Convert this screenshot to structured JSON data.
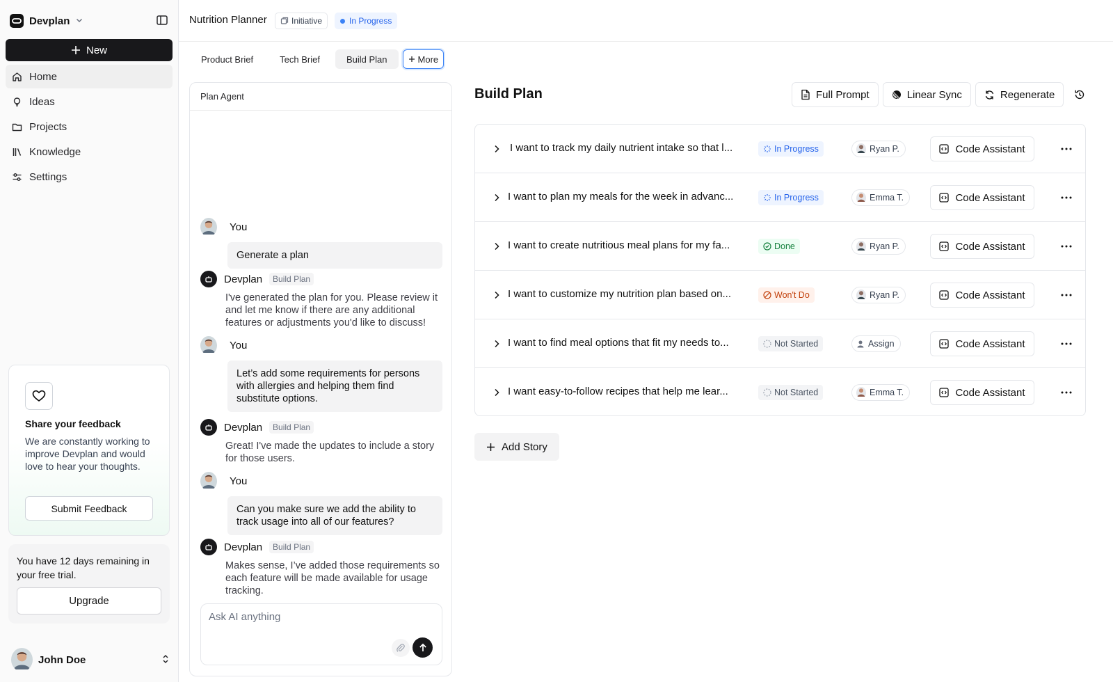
{
  "sidebar": {
    "brand": "Devplan",
    "new_label": "New",
    "nav": [
      {
        "label": "Home",
        "icon": "home-icon",
        "active": true
      },
      {
        "label": "Ideas",
        "icon": "lightbulb-icon"
      },
      {
        "label": "Projects",
        "icon": "folder-icon"
      },
      {
        "label": "Knowledge",
        "icon": "library-icon"
      },
      {
        "label": "Settings",
        "icon": "sliders-icon"
      }
    ],
    "feedback": {
      "title": "Share your feedback",
      "text": "We are constantly working to improve Devplan and would love to hear your thoughts.",
      "button": "Submit Feedback"
    },
    "trial": {
      "text": "You have 12 days remaining in your free trial.",
      "button": "Upgrade"
    },
    "user": {
      "name": "John Doe"
    }
  },
  "header": {
    "title": "Nutrition Planner",
    "type_badge": "Initiative",
    "status_badge": "In Progress"
  },
  "tabs": [
    {
      "label": "Product Brief"
    },
    {
      "label": "Tech Brief"
    },
    {
      "label": "Build Plan",
      "active": true
    },
    {
      "label": "More"
    }
  ],
  "chat": {
    "header": "Plan Agent",
    "messages": [
      {
        "author": "You",
        "text": "Generate a plan"
      },
      {
        "author": "Devplan",
        "tag": "Build Plan",
        "text": "I've generated the plan for you. Please review it and let me know if there are any additional features or adjustments you'd like to discuss!"
      },
      {
        "author": "You",
        "text": "Let’s add some requirements for persons with allergies and helping them find substitute options."
      },
      {
        "author": "Devplan",
        "tag": "Build Plan",
        "text": "Great! I've made the updates to include a story for those users."
      },
      {
        "author": "You",
        "text": "Can you make sure we add the ability to track usage into all of our features?"
      },
      {
        "author": "Devplan",
        "tag": "Build Plan",
        "text": "Makes sense, I’ve added those requirements so each feature will be made available for usage tracking."
      }
    ],
    "placeholder": "Ask AI anything"
  },
  "build_plan": {
    "title": "Build Plan",
    "actions": {
      "full_prompt": "Full Prompt",
      "linear_sync": "Linear Sync",
      "regenerate": "Regenerate"
    },
    "stories": [
      {
        "text": "I want to track my daily nutrient intake so that l...",
        "status": "In Progress",
        "status_kind": "inprogress",
        "assignee": "Ryan P."
      },
      {
        "text": "I want to plan my meals for the week in advanc...",
        "status": "In Progress",
        "status_kind": "inprogress",
        "assignee": "Emma T."
      },
      {
        "text": "I want to create nutritious meal plans for my fa...",
        "status": "Done",
        "status_kind": "done",
        "assignee": "Ryan P."
      },
      {
        "text": "I want to customize my nutrition plan based on...",
        "status": "Won't Do",
        "status_kind": "wontdo",
        "assignee": "Ryan P."
      },
      {
        "text": "I want to find meal options that fit my needs to...",
        "status": "Not Started",
        "status_kind": "notstarted",
        "assignee": "Assign"
      },
      {
        "text": "I want easy-to-follow recipes that help me lear...",
        "status": "Not Started",
        "status_kind": "notstarted",
        "assignee": "Emma T."
      }
    ],
    "code_assistant_label": "Code Assistant",
    "add_story": "Add Story"
  },
  "colors": {
    "accent": "#2563eb",
    "dark": "#18181b",
    "done": "#15803d",
    "wontdo": "#c2410c"
  }
}
